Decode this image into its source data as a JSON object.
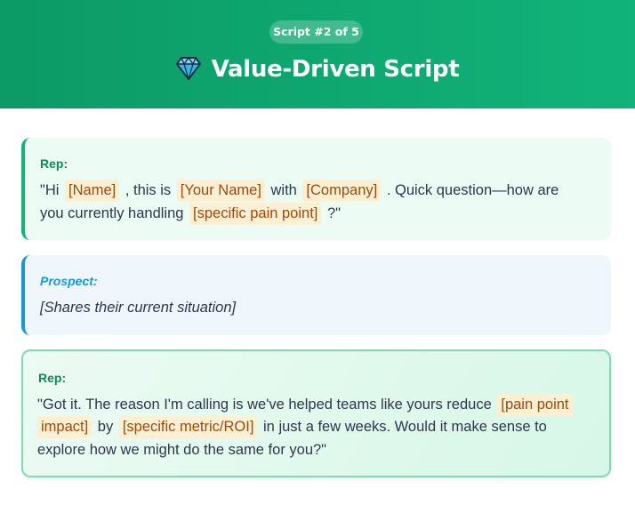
{
  "header": {
    "badge": "Script #2 of 5",
    "icon": "gem-icon",
    "title": "Value-Driven Script",
    "colors": {
      "gradient_start": "#0c9a66",
      "gradient_end": "#11b37a"
    }
  },
  "cards": [
    {
      "speaker": "Rep:",
      "line1": {
        "t1": "\"Hi",
        "p1": "[Name]",
        "t2": ", this is",
        "p2": "[Your Name]",
        "t3": "with",
        "p3": "[Company]",
        "t4": ". Quick question—how are"
      },
      "line2": {
        "t1": "you currently handling",
        "p1": "[specific pain point]",
        "t2": "?\""
      }
    },
    {
      "speaker": "Prospect:",
      "text": "[Shares their current situation]"
    },
    {
      "speaker": "Rep:",
      "line1": {
        "t1": "\"Got it. The reason I'm calling is we've helped teams like yours reduce",
        "p1": "[pain point"
      },
      "line2": {
        "p1": "impact]",
        "t1": "by",
        "p2": "[specific metric/ROI]",
        "t2": "in just a few weeks. Would it make sense to"
      },
      "line3": {
        "t1": "explore how we might do the same for you?\""
      }
    }
  ],
  "colors": {
    "rep_accent": "#12b376",
    "prospect_accent": "#1797d8",
    "placeholder_bg": "#fdf0d2",
    "placeholder_text": "#9a4a0f"
  }
}
